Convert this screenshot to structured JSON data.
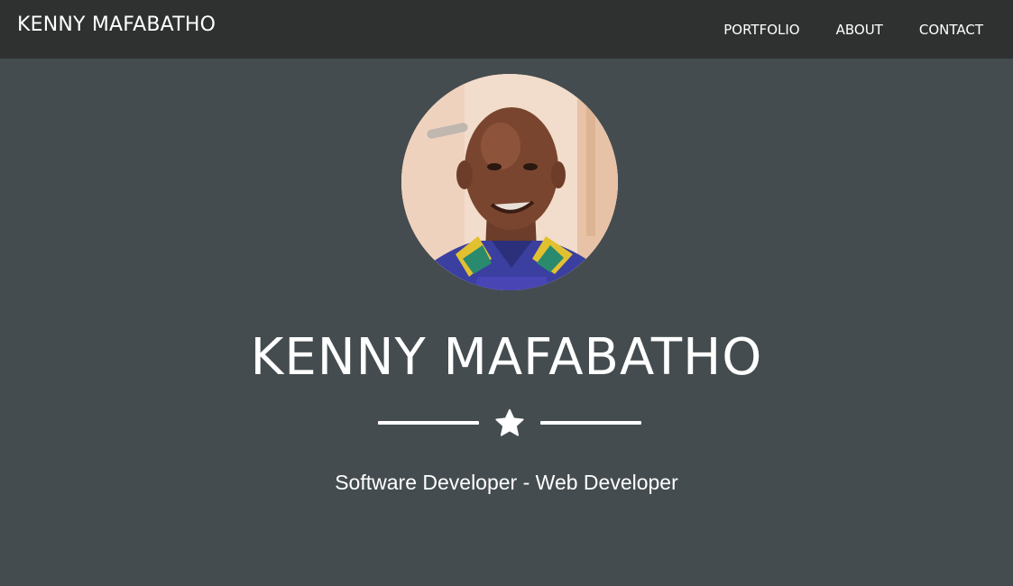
{
  "navbar": {
    "brand": "KENNY MAFABATHO",
    "links": [
      {
        "label": "PORTFOLIO"
      },
      {
        "label": "ABOUT"
      },
      {
        "label": "CONTACT"
      }
    ]
  },
  "hero": {
    "avatar_icon": "profile-photo",
    "title": "KENNY MAFABATHO",
    "divider_icon": "star-icon",
    "subtitle": "Software Developer - Web Developer"
  },
  "colors": {
    "navbar_bg": "#2f3131",
    "hero_bg": "#444c4f",
    "text": "#ffffff"
  }
}
